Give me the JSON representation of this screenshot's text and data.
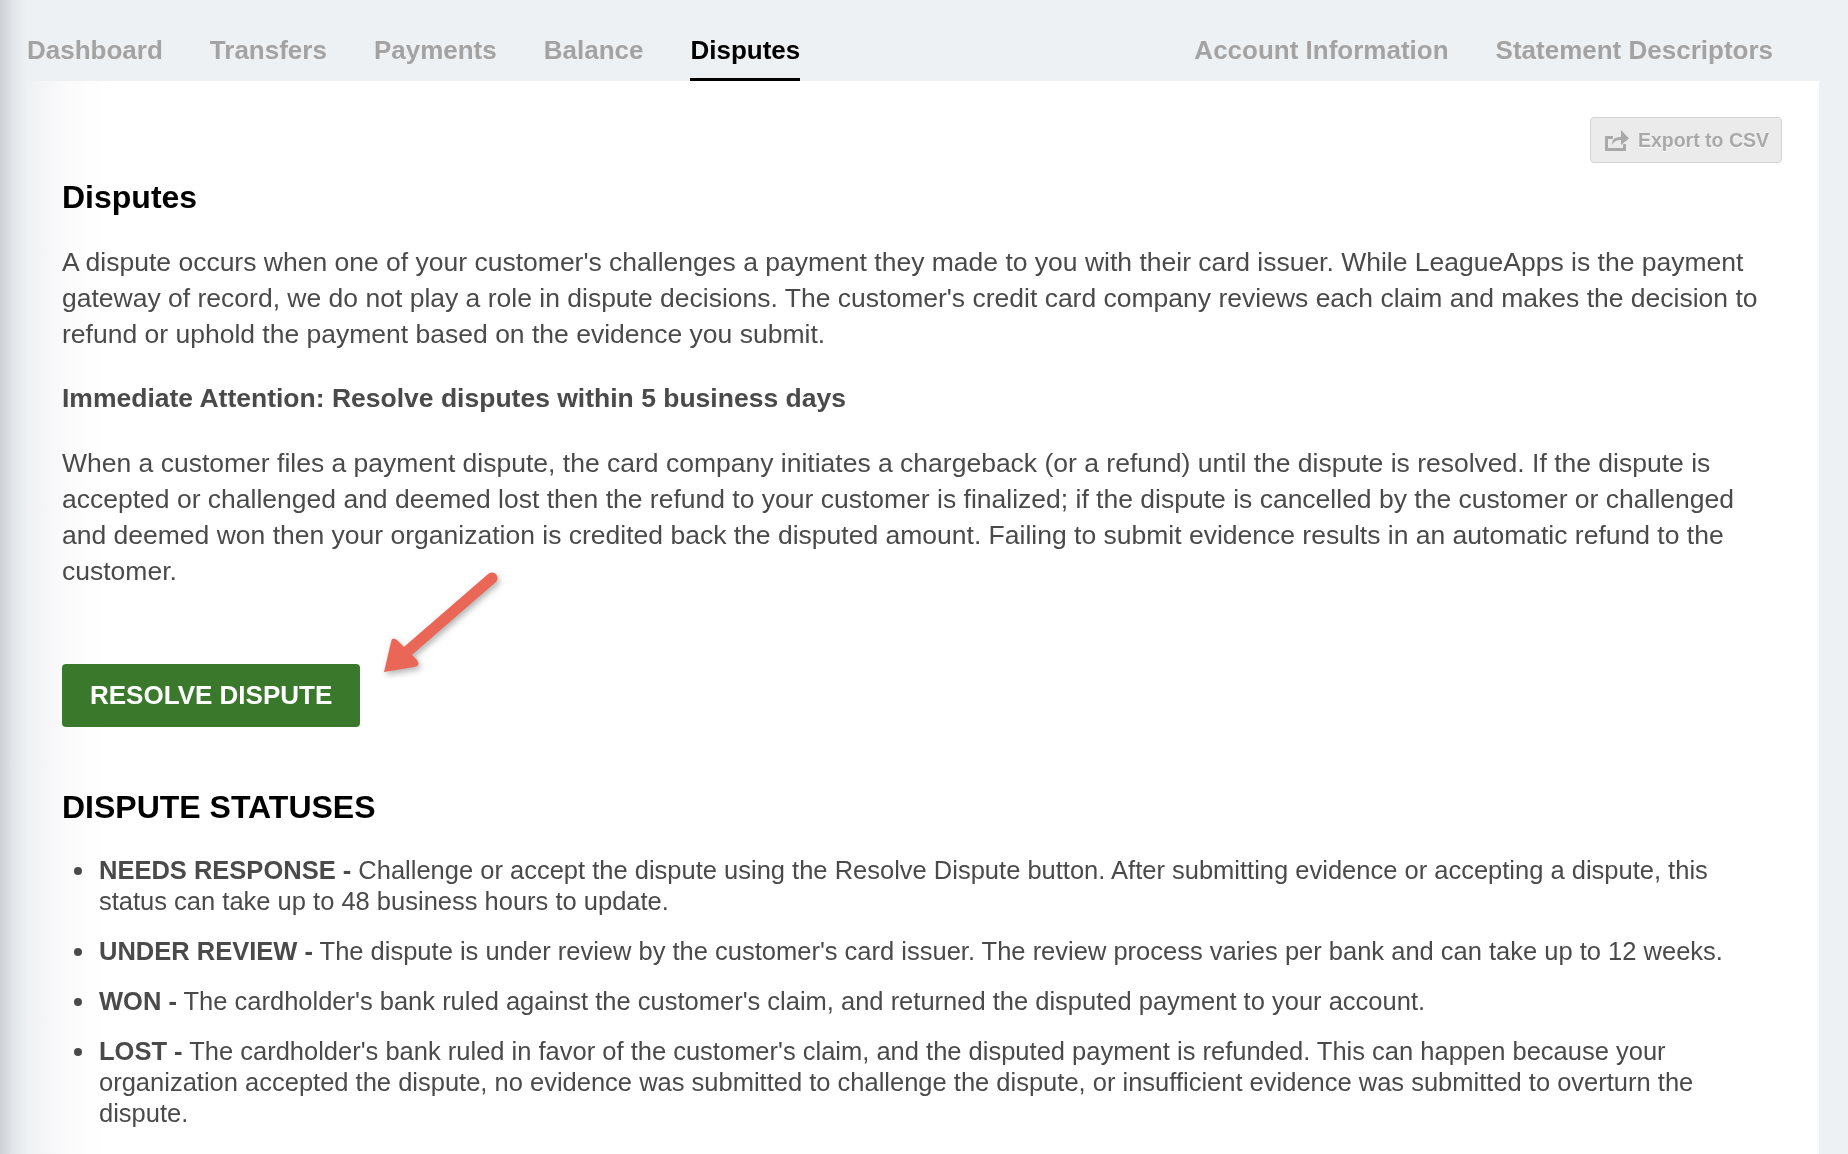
{
  "nav": {
    "main_tabs": [
      {
        "label": "Dashboard",
        "selected": false
      },
      {
        "label": "Transfers",
        "selected": false
      },
      {
        "label": "Payments",
        "selected": false
      },
      {
        "label": "Balance",
        "selected": false
      },
      {
        "label": "Disputes",
        "selected": true
      }
    ],
    "account_tabs": [
      {
        "label": "Account Information",
        "selected": false
      },
      {
        "label": "Statement Descriptors",
        "selected": false
      }
    ]
  },
  "export_button": {
    "label": "Export to CSV",
    "disabled": true
  },
  "page": {
    "title": "Disputes",
    "intro": "A dispute occurs when one of your customer's challenges a payment they made to you with their card issuer. While LeagueApps is the payment gateway of record, we do not play a role in dispute decisions. The customer's credit card company reviews each claim and makes the decision to refund or uphold the payment based on the evidence you submit.",
    "notice": "Immediate Attention: Resolve disputes within 5 business days",
    "explanation": "When a customer files a payment dispute, the card company initiates a chargeback (or a refund) until the dispute is resolved. If the dispute is accepted or challenged and deemed lost then the refund to your customer is finalized; if the dispute is cancelled by the customer or challenged and deemed won then your organization is credited back the disputed amount. Failing to submit evidence results in an automatic refund to the customer.",
    "action_button": "RESOLVE DISPUTE",
    "statuses_title": "DISPUTE STATUSES",
    "statuses": [
      "**NEEDS RESPONSE -** Challenge or accept the dispute using the Resolve Dispute button. After submitting evidence or accepting a dispute, this status can take up to 48 business hours to update.",
      "**UNDER REVIEW -** The dispute is under review by the customer's card issuer. The review process varies per bank and can take up to 12 weeks.",
      "**WON -** The cardholder's bank ruled against the customer's claim, and returned the disputed payment to your account.",
      "**LOST -** The cardholder's bank ruled in favor of the customer's claim, and the disputed payment is refunded. This can happen because your organization accepted the dispute, no evidence was submitted to challenge the dispute, or insufficient evidence was submitted to overturn the dispute."
    ]
  }
}
